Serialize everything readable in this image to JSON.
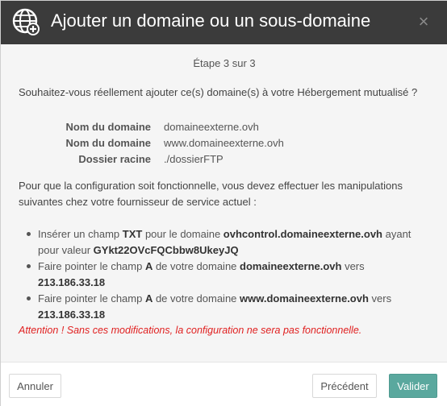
{
  "dialog": {
    "title": "Ajouter un domaine ou un sous-domaine",
    "close_symbol": "×",
    "icons": {
      "logo": "globe-add-icon",
      "close": "close-icon"
    },
    "colors": {
      "header": "#3b3b3b",
      "primary": "#5aa89e",
      "warning": "#e02020"
    }
  },
  "content": {
    "step": "Étape 3 sur 3",
    "question": "Souhaitez-vous réellement ajouter ce(s) domaine(s) à votre Hébergement mutualisé ?",
    "details": [
      {
        "label": "Nom du domaine",
        "value": "domaineexterne.ovh"
      },
      {
        "label": "Nom du domaine",
        "value": "www.domaineexterne.ovh"
      },
      {
        "label": "Dossier racine",
        "value": "./dossierFTP"
      }
    ],
    "instructions": "Pour que la configuration soit fonctionnelle, vous devez effectuer les manipulations suivantes chez votre fournisseur de service actuel :",
    "steps": [
      {
        "t1": "Insérer un champ ",
        "b1": "TXT",
        "t2": " pour le domaine ",
        "b2": "ovhcontrol.domaineexterne.ovh",
        "t3": " ayant pour valeur ",
        "b3": "GYkt22OVcFQCbbw8UkeyJQ"
      },
      {
        "t1": "Faire pointer le champ ",
        "b1": "A",
        "t2": " de votre domaine ",
        "b2": "domaineexterne.ovh",
        "t3": " vers ",
        "b3": "213.186.33.18"
      },
      {
        "t1": "Faire pointer le champ ",
        "b1": "A",
        "t2": " de votre domaine ",
        "b2": "www.domaineexterne.ovh",
        "t3": " vers ",
        "b3": "213.186.33.18"
      }
    ],
    "warning": "Attention ! Sans ces modifications, la configuration ne sera pas fonctionnelle."
  },
  "footer": {
    "cancel": "Annuler",
    "previous": "Précédent",
    "confirm": "Valider"
  }
}
